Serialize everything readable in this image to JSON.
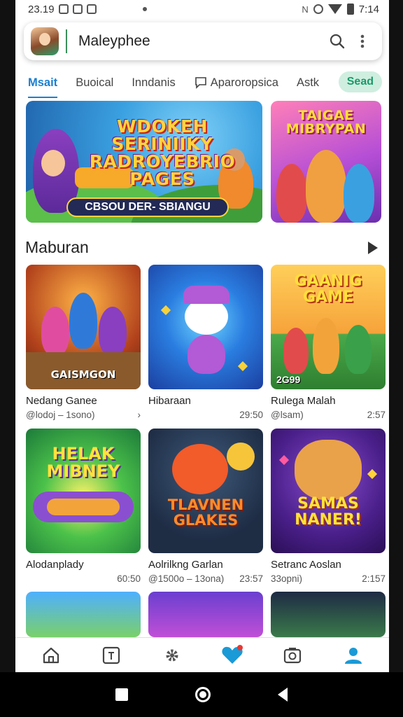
{
  "status": {
    "time_left": "23.19",
    "time_right": "7:14"
  },
  "search": {
    "value": "Maleyphee"
  },
  "tabs": [
    {
      "label": "Msait"
    },
    {
      "label": "Buoical"
    },
    {
      "label": "Inndanis"
    },
    {
      "label": "Aparoropsica"
    },
    {
      "label": "Astk"
    },
    {
      "label": "Sead"
    }
  ],
  "banners": [
    {
      "title": "WDOKEH SERINIIKY RADROYEBRIO PAGES",
      "pill": "CBSOU DER- SBIANGU"
    },
    {
      "title": "TAIGAE MIBRYPAN"
    }
  ],
  "section": {
    "title": "Maburan"
  },
  "cards": [
    {
      "thumb_label": "GAISMGON",
      "name": "Nedang Ganee",
      "meta_left": "@lodoj – 1sono)",
      "meta_right": "›"
    },
    {
      "thumb_label": "",
      "name": "Hibaraan",
      "meta_left": "",
      "meta_right": "29:50"
    },
    {
      "thumb_label": "GAANIG GAME",
      "thumb_sub": "2G99",
      "name": "Rulega Malah",
      "meta_left": "@lsam)",
      "meta_right": "2:57"
    },
    {
      "thumb_label": "HELAK MIBNEY",
      "name": "Alodanplady",
      "meta_left": "",
      "meta_right": "60:50"
    },
    {
      "thumb_label": "TLAVNEN GLAKES",
      "name": "Aolrilkng Garlan",
      "meta_left": "@1500o – 13ona)",
      "meta_right": "23:57"
    },
    {
      "thumb_label": "SAMAS NANER!",
      "name": "Setranc Aoslan",
      "meta_left": "33opni)",
      "meta_right": "2:157"
    }
  ],
  "colors": {
    "accent": "#1a7fd0",
    "chip_bg": "#cfeee0",
    "chip_text": "#1a9a6a",
    "nav_active": "#1a9ad6"
  }
}
